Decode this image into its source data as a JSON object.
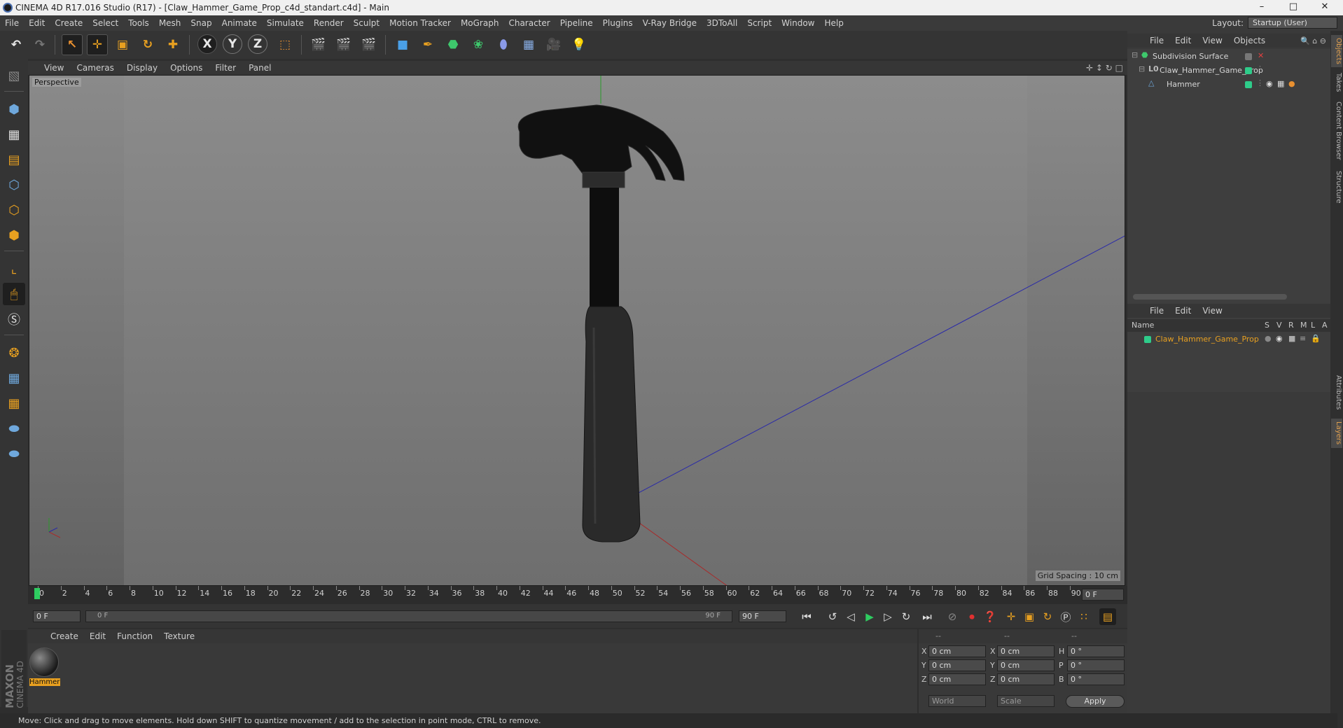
{
  "window": {
    "title": "CINEMA 4D R17.016 Studio (R17) - [Claw_Hammer_Game_Prop_c4d_standart.c4d] - Main",
    "controls": [
      "–",
      "□",
      "✕"
    ]
  },
  "menu": [
    "File",
    "Edit",
    "Create",
    "Select",
    "Tools",
    "Mesh",
    "Snap",
    "Animate",
    "Simulate",
    "Render",
    "Sculpt",
    "Motion Tracker",
    "MoGraph",
    "Character",
    "Pipeline",
    "Plugins",
    "V-Ray Bridge",
    "3DToAll",
    "Script",
    "Window",
    "Help"
  ],
  "layout": {
    "label": "Layout:",
    "value": "Startup (User)"
  },
  "toolbar_axes": [
    "X",
    "Y",
    "Z"
  ],
  "viewport": {
    "menu": [
      "View",
      "Cameras",
      "Display",
      "Options",
      "Filter",
      "Panel"
    ],
    "label": "Perspective",
    "grid_spacing": "Grid Spacing : 10 cm"
  },
  "timeline": {
    "ticks": [
      "0",
      "2",
      "4",
      "6",
      "8",
      "10",
      "12",
      "14",
      "16",
      "18",
      "20",
      "22",
      "24",
      "26",
      "28",
      "30",
      "32",
      "34",
      "36",
      "38",
      "40",
      "42",
      "44",
      "46",
      "48",
      "50",
      "52",
      "54",
      "56",
      "58",
      "60",
      "62",
      "64",
      "66",
      "68",
      "70",
      "72",
      "74",
      "76",
      "78",
      "80",
      "82",
      "84",
      "86",
      "88",
      "90"
    ],
    "current_frame": "0 F",
    "start_field": "0 F",
    "range_start": "0 F",
    "range_end": "90 F",
    "end_field": "90 F"
  },
  "material_panel": {
    "menu": [
      "Create",
      "Edit",
      "Function",
      "Texture"
    ],
    "materials": [
      {
        "name": "Hammer"
      }
    ]
  },
  "coordinates": {
    "header": [
      "--",
      "--",
      "--"
    ],
    "rows": [
      {
        "axis": "X",
        "pos": "0 cm",
        "axis2": "X",
        "size": "0 cm",
        "axis3": "H",
        "rot": "0 °"
      },
      {
        "axis": "Y",
        "pos": "0 cm",
        "axis2": "Y",
        "size": "0 cm",
        "axis3": "P",
        "rot": "0 °"
      },
      {
        "axis": "Z",
        "pos": "0 cm",
        "axis2": "Z",
        "size": "0 cm",
        "axis3": "B",
        "rot": "0 °"
      }
    ],
    "mode": "World",
    "type": "Scale",
    "apply": "Apply"
  },
  "object_manager": {
    "menu": [
      "File",
      "Edit",
      "View",
      "Objects"
    ],
    "objects": [
      {
        "name": "Subdivision Surface",
        "indent": 0,
        "color": "#2ecc8a"
      },
      {
        "name": "Claw_Hammer_Game_Prop",
        "indent": 1,
        "color": "#2ecc8a"
      },
      {
        "name": "Hammer",
        "indent": 2,
        "color": "#2ecc8a"
      }
    ]
  },
  "layer_manager": {
    "menu": [
      "File",
      "Edit",
      "View"
    ],
    "columns": [
      "Name",
      "S",
      "V",
      "R",
      "M",
      "L",
      "A"
    ],
    "layers": [
      {
        "name": "Claw_Hammer_Game_Prop",
        "color": "#2ecc8a"
      }
    ]
  },
  "side_tabs": [
    "Objects",
    "Takes",
    "Content Browser",
    "Structure",
    "Attributes",
    "Layers"
  ],
  "brand": {
    "line1": "MAXON",
    "line2": "CINEMA 4D"
  },
  "status": "Move: Click and drag to move elements. Hold down SHIFT to quantize movement / add to the selection in point mode, CTRL to remove.",
  "colors": {
    "accent": "#e8a020",
    "object_green": "#2ecc8a",
    "x_axis": "#c03030",
    "y_axis": "#30b030",
    "z_axis": "#3030c0"
  }
}
